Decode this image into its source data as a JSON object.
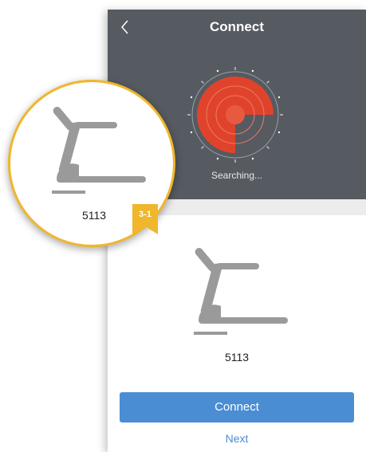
{
  "header": {
    "title": "Connect",
    "back_icon": "chevron-left-icon"
  },
  "scan": {
    "status_text": "Searching..."
  },
  "device": {
    "icon": "treadmill-icon",
    "name": "5113"
  },
  "actions": {
    "connect_label": "Connect",
    "next_label": "Next"
  },
  "callout": {
    "device_name": "5113",
    "badge_label": "3-1"
  },
  "colors": {
    "header_bg": "#565a61",
    "radar_red": "#e0432b",
    "accent_blue": "#4a8dd3",
    "callout_gold": "#f0b62c"
  }
}
